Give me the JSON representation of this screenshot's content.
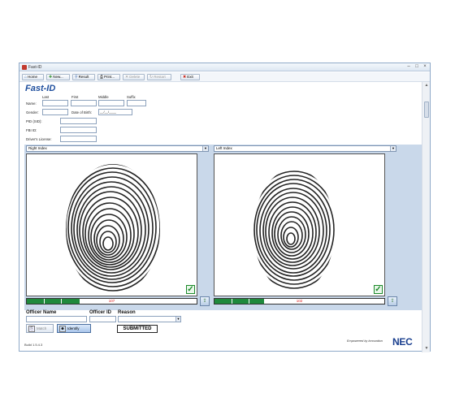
{
  "window": {
    "title": "Fast-ID"
  },
  "toolbar": {
    "home": "Home",
    "new": "New...",
    "result": "Result",
    "print": "Print...",
    "delete": "Delete",
    "restart": "Restart",
    "exit": "Exit"
  },
  "logo": "Fast-ID",
  "form": {
    "col_last": "Last",
    "col_first": "First",
    "col_middle": "Middle",
    "col_suffix": "Suffix",
    "name_label": "Name:",
    "gender_label": "Gender:",
    "dob_label": "Date of Birth:",
    "dob_value": "__/__/____",
    "pid_label": "PID (SID):",
    "fbi_label": "FBI ID:",
    "dl_label": "Driver's License:"
  },
  "panels": [
    {
      "finger": "Right Index",
      "quality": 107,
      "quality_fraction": 0.31
    },
    {
      "finger": "Left Index",
      "quality": 102,
      "quality_fraction": 0.29
    }
  ],
  "officer": {
    "name_label": "Officer Name",
    "id_label": "Officer ID",
    "reason_label": "Reason"
  },
  "actions": {
    "match": "Match",
    "identify": "Identify"
  },
  "status": "SUBMITTED",
  "footer": {
    "build": "Build 1.5.4.3",
    "tagline": "Empowered by Innovation",
    "brand": "NEC"
  },
  "colors": {
    "accent": "#1f4f9e",
    "quality_fill": "#1f8a3c",
    "quality_text": "#dd2222",
    "panel_bg": "#c9d8ea"
  }
}
